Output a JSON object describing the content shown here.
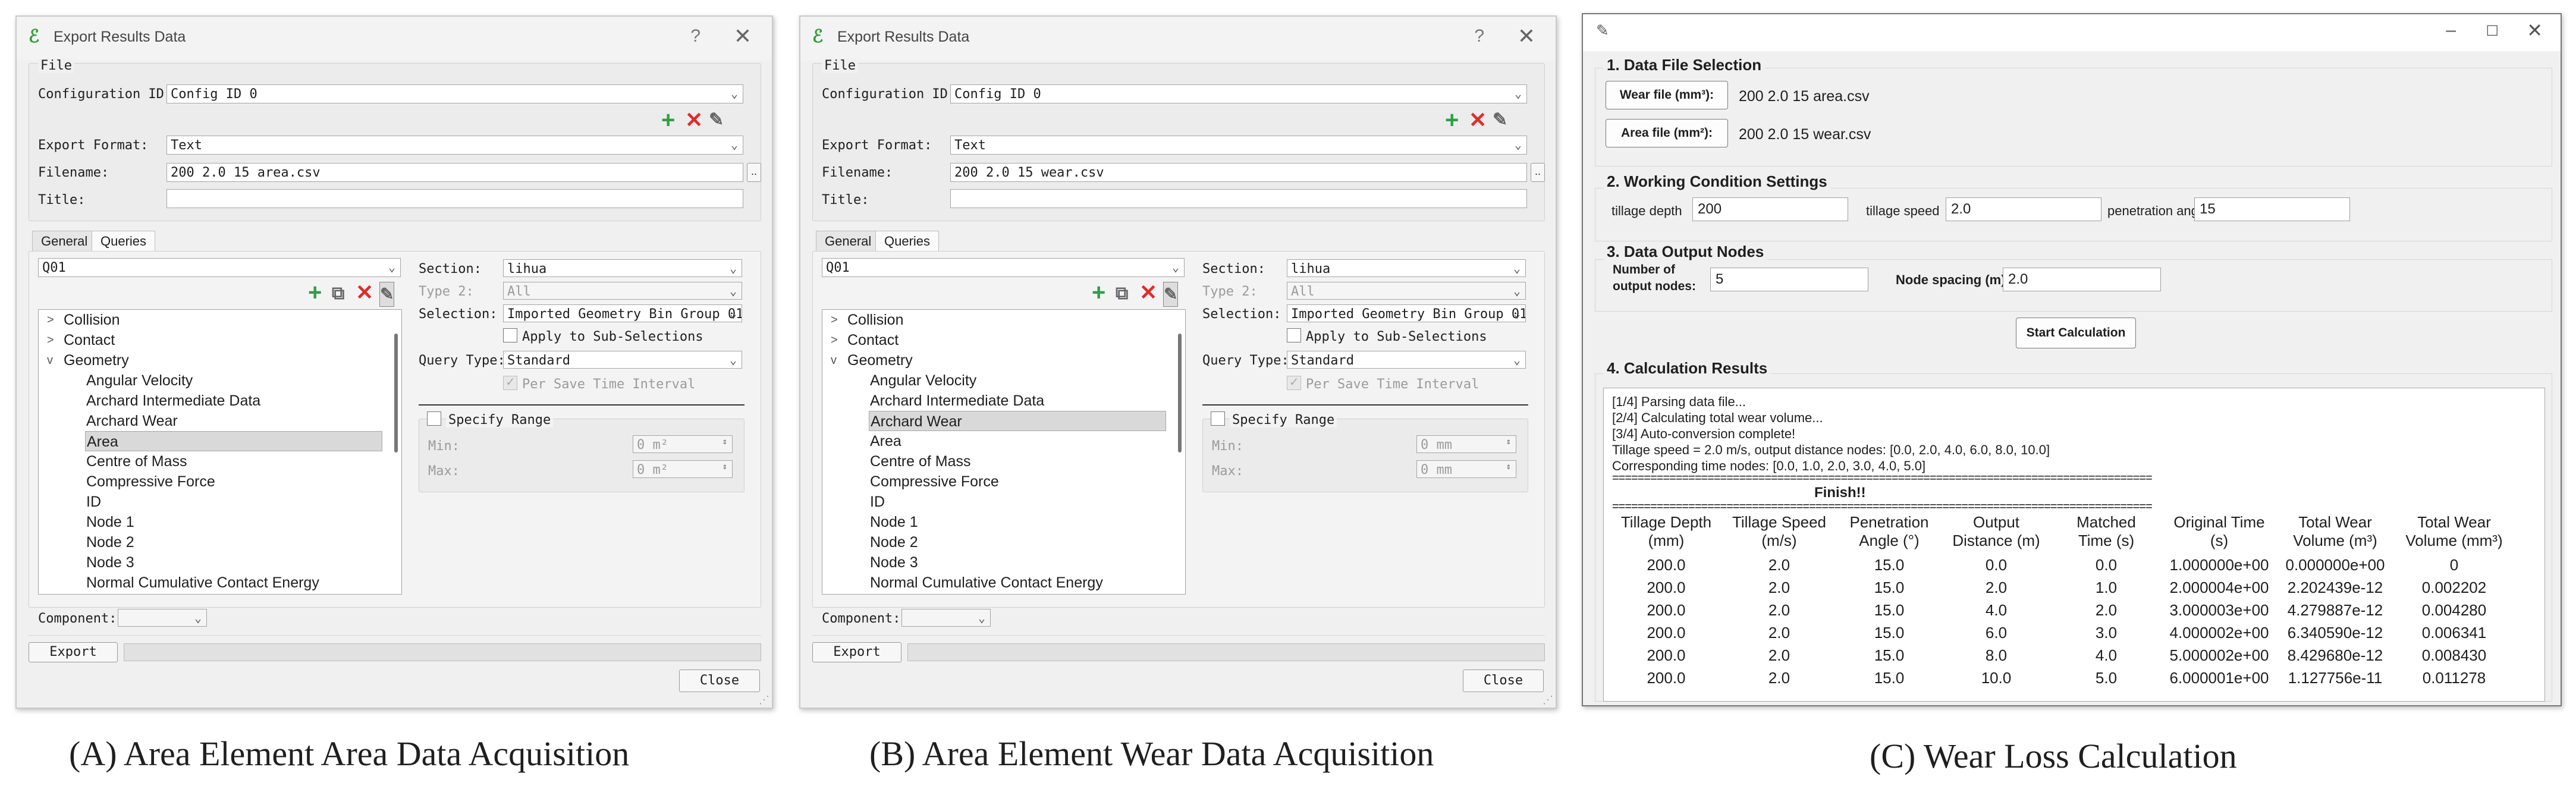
{
  "dialogs": [
    {
      "title": "Export Results Data",
      "title_help": "?",
      "file_group": "File",
      "config_label": "Configuration ID:",
      "config_value": "Config ID 0",
      "format_label": "Export Format:",
      "format_value": "Text",
      "filename_label": "Filename:",
      "filename_value": "200 2.0 15 area.csv",
      "browse_label": "..",
      "title_field_label": "Title:",
      "title_field_value": "",
      "tabs": [
        "General",
        "Queries"
      ],
      "query_value": "Q01",
      "section_label": "Section:",
      "section_value": "lihua",
      "type2_label": "Type 2:",
      "type2_value": "All",
      "selection_label": "Selection:",
      "selection_value": "Imported Geometry Bin Group 01",
      "apply_sub_label": "Apply to Sub-Selections",
      "query_type_label": "Query Type:",
      "query_type_value": "Standard",
      "per_save_label": "Per Save Time Interval",
      "specify_range_label": "Specify Range",
      "min_label": "Min:",
      "min_value": "0 m²",
      "max_label": "Max:",
      "max_value": "0 m²",
      "component_label": "Component:",
      "component_value": "",
      "export_label": "Export",
      "close_label": "Close",
      "tree": [
        {
          "label": "Collision",
          "arrow": ">"
        },
        {
          "label": "Contact",
          "arrow": ">"
        },
        {
          "label": "Geometry",
          "arrow": "v"
        },
        {
          "label": "Angular Velocity"
        },
        {
          "label": "Archard Intermediate Data"
        },
        {
          "label": "Archard Wear"
        },
        {
          "label": "Area",
          "selected": true
        },
        {
          "label": "Centre of Mass"
        },
        {
          "label": "Compressive Force"
        },
        {
          "label": "ID"
        },
        {
          "label": "Node 1"
        },
        {
          "label": "Node 2"
        },
        {
          "label": "Node 3"
        },
        {
          "label": "Normal Cumulative Contact Energy"
        }
      ]
    },
    {
      "title": "Export Results Data",
      "title_help": "?",
      "file_group": "File",
      "config_label": "Configuration ID:",
      "config_value": "Config ID 0",
      "format_label": "Export Format:",
      "format_value": "Text",
      "filename_label": "Filename:",
      "filename_value": "200 2.0 15 wear.csv",
      "browse_label": "..",
      "title_field_label": "Title:",
      "title_field_value": "",
      "tabs": [
        "General",
        "Queries"
      ],
      "query_value": "Q01",
      "section_label": "Section:",
      "section_value": "lihua",
      "type2_label": "Type 2:",
      "type2_value": "All",
      "selection_label": "Selection:",
      "selection_value": "Imported Geometry Bin Group 01",
      "apply_sub_label": "Apply to Sub-Selections",
      "query_type_label": "Query Type:",
      "query_type_value": "Standard",
      "per_save_label": "Per Save Time Interval",
      "specify_range_label": "Specify Range",
      "min_label": "Min:",
      "min_value": "0 mm",
      "max_label": "Max:",
      "max_value": "0 mm",
      "component_label": "Component:",
      "component_value": "",
      "export_label": "Export",
      "close_label": "Close",
      "tree": [
        {
          "label": "Collision",
          "arrow": ">"
        },
        {
          "label": "Contact",
          "arrow": ">"
        },
        {
          "label": "Geometry",
          "arrow": "v"
        },
        {
          "label": "Angular Velocity"
        },
        {
          "label": "Archard Intermediate Data"
        },
        {
          "label": "Archard Wear",
          "selected": true
        },
        {
          "label": "Area"
        },
        {
          "label": "Centre of Mass"
        },
        {
          "label": "Compressive Force"
        },
        {
          "label": "ID"
        },
        {
          "label": "Node 1"
        },
        {
          "label": "Node 2"
        },
        {
          "label": "Node 3"
        },
        {
          "label": "Normal Cumulative Contact Energy"
        }
      ]
    }
  ],
  "calc": {
    "section1_title": "1. Data File Selection",
    "wear_btn": "Wear file (mm³):",
    "wear_file": "200 2.0 15 area.csv",
    "area_btn": "Area file (mm²):",
    "area_file": "200 2.0 15 wear.csv",
    "section2_title": "2. Working Condition Settings",
    "depth_label": "tillage depth",
    "depth_value": "200",
    "speed_label": "tillage speed",
    "speed_value": "2.0",
    "angle_label": "penetration angle",
    "angle_value": "15",
    "section3_title": "3. Data Output Nodes",
    "nodes_label_1": "Number of",
    "nodes_label_2": "output nodes:",
    "nodes_value": "5",
    "spacing_label": "Node spacing (m):",
    "spacing_value": "2.0",
    "start_btn": "Start Calculation",
    "section4_title": "4. Calculation Results",
    "log": [
      "[1/4] Parsing data file...",
      "[2/4] Calculating total wear volume...",
      "[3/4] Auto-conversion complete!",
      "Tillage speed = 2.0 m/s, output distance nodes: [0.0, 2.0, 4.0, 6.0, 8.0, 10.0]",
      "Corresponding time nodes: [0.0, 1.0, 2.0, 3.0, 4.0, 5.0]"
    ],
    "separator": "=====================================================================================",
    "finish": "Finish!!",
    "headers": [
      [
        "Tillage Depth",
        "(mm)"
      ],
      [
        "Tillage Speed",
        "(m/s)"
      ],
      [
        "Penetration",
        "Angle (°)"
      ],
      [
        "Output",
        "Distance (m)"
      ],
      [
        "Matched",
        "Time (s)"
      ],
      [
        "Original Time",
        "(s)"
      ],
      [
        "Total Wear",
        "Volume (m³)"
      ],
      [
        "Total Wear",
        "Volume (mm³)"
      ]
    ],
    "rows": [
      [
        "200.0",
        "2.0",
        "15.0",
        "0.0",
        "0.0",
        "1.000000e+00",
        "0.000000e+00",
        "0"
      ],
      [
        "200.0",
        "2.0",
        "15.0",
        "2.0",
        "1.0",
        "2.000004e+00",
        "2.202439e-12",
        "0.002202"
      ],
      [
        "200.0",
        "2.0",
        "15.0",
        "4.0",
        "2.0",
        "3.000003e+00",
        "4.279887e-12",
        "0.004280"
      ],
      [
        "200.0",
        "2.0",
        "15.0",
        "6.0",
        "3.0",
        "4.000002e+00",
        "6.340590e-12",
        "0.006341"
      ],
      [
        "200.0",
        "2.0",
        "15.0",
        "8.0",
        "4.0",
        "5.000002e+00",
        "8.429680e-12",
        "0.008430"
      ],
      [
        "200.0",
        "2.0",
        "15.0",
        "10.0",
        "5.0",
        "6.000001e+00",
        "1.127756e-11",
        "0.011278"
      ]
    ]
  },
  "captions": [
    "(A)    Area Element Area Data Acquisition",
    "(B) Area Element Wear Data Acquisition",
    "(C) Wear Loss Calculation"
  ]
}
